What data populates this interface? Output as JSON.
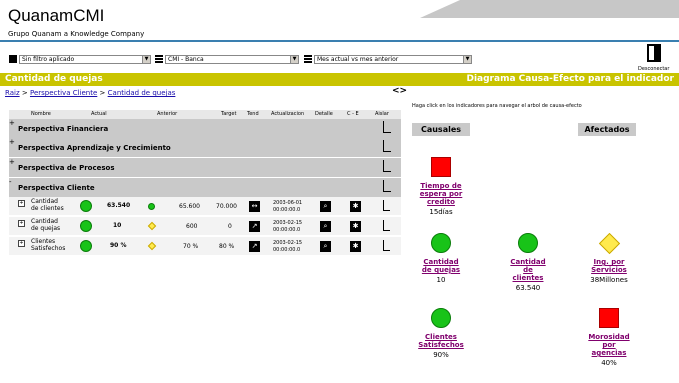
{
  "brand": {
    "name": "QuanamCMI",
    "tagline": "Grupo Quanam a Knowledge Company"
  },
  "filters": {
    "filter": "Sin filtro aplicado",
    "scorecard": "CMI - Banca",
    "compare": "Mes actual vs mes anterior",
    "disconnect": "Desconectar"
  },
  "titles": {
    "left": "Cantidad de quejas",
    "right": "Diagrama Causa-Efecto para el indicador"
  },
  "breadcrumb": {
    "root": "Raiz",
    "sep1": ">",
    "p1": "Perspectiva Cliente",
    "sep2": ">",
    "p2": "Cantidad de quejas"
  },
  "arrows": "<>",
  "hint": "Haga click en los indicadores para navegar el arbol de causa-efecto",
  "columns": [
    "Nombre",
    "Actual",
    "Anterior",
    "Target",
    "Tend",
    "Actualizacion",
    "Detalle",
    "C - E",
    "Aislar"
  ],
  "perspectives": [
    {
      "toggle": "+",
      "name": "Perspectiva Financiera"
    },
    {
      "toggle": "+",
      "name": "Perspectiva Aprendizaje y Crecimiento"
    },
    {
      "toggle": "+",
      "name": "Perspectiva de Procesos"
    },
    {
      "toggle": "-",
      "name": "Perspectiva Cliente"
    }
  ],
  "rows": [
    {
      "name1": "Cantidad",
      "name2": "de clientes",
      "actual": "63.540",
      "anterior": "65.600",
      "target": "70.000",
      "date1": "2003-06-01",
      "date2": "00:00:00.0",
      "tend": "flat",
      "status": "green",
      "prevstatus": "green"
    },
    {
      "name1": "Cantidad",
      "name2": "de quejas",
      "actual": "10",
      "anterior": "600",
      "target": "0",
      "date1": "2003-02-15",
      "date2": "00:00:00.0",
      "tend": "up",
      "status": "green",
      "prevstatus": "yellow"
    },
    {
      "name1": "Clientes",
      "name2": "Satisfechos",
      "actual": "90 %",
      "anterior": "70 %",
      "target": "80 %",
      "date1": "2003-02-15",
      "date2": "00:00:00.0",
      "tend": "up",
      "status": "green",
      "prevstatus": "yellow"
    }
  ],
  "panel": {
    "causales": "Causales",
    "afectados": "Afectados",
    "nodes": {
      "tiempo": {
        "l1": "Tiempo de",
        "l2": "espera por",
        "l3": "credito",
        "value": "15días",
        "shape": "red"
      },
      "quejas": {
        "l1": "Cantidad",
        "l2": "de quejas",
        "value": "10",
        "shape": "green"
      },
      "clientes": {
        "l1": "Cantidad",
        "l2": "de",
        "l3": "clientes",
        "value": "63.540",
        "shape": "green"
      },
      "ing": {
        "l1": "Ing. por",
        "l2": "Servicios",
        "value": "38Millones",
        "shape": "yellow"
      },
      "satisf": {
        "l1": "Clientes",
        "l2": "Satisfechos",
        "value": "90%",
        "shape": "green"
      },
      "moros": {
        "l1": "Morosidad",
        "l2": "por",
        "l3": "agencias",
        "value": "40%",
        "shape": "red"
      }
    }
  },
  "colors": {
    "accent_bar": "#c9c400",
    "link": "#80006d",
    "status_green": "#18c318",
    "status_red": "#ff0000",
    "status_yellow": "#ffea4d"
  }
}
